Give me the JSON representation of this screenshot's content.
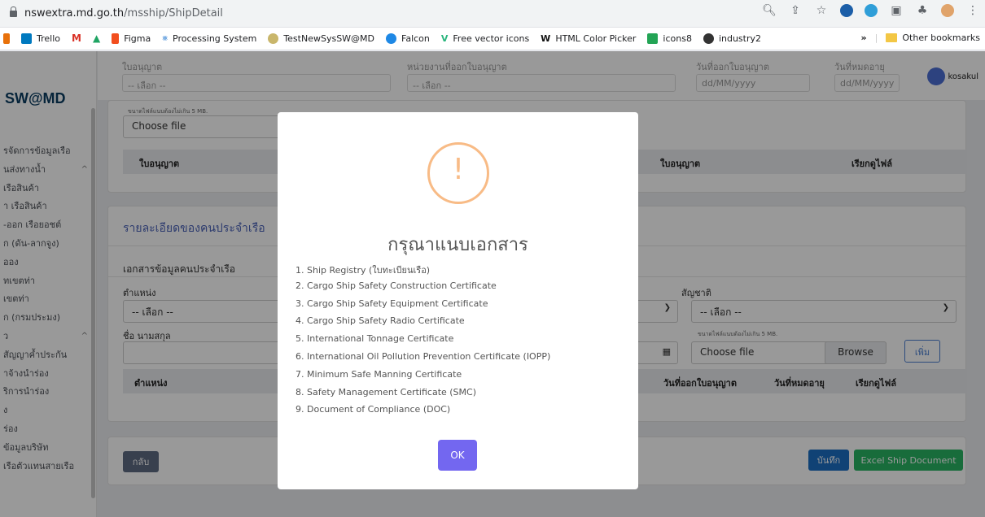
{
  "browser": {
    "url_host": "nswextra.md.go.th",
    "url_path": "/msship/ShipDetail",
    "bookmarks": [
      "Trello",
      "Figma",
      "Processing System",
      "TestNewSysSW@MD",
      "Falcon",
      "Free vector icons",
      "HTML Color Picker",
      "icons8",
      "industry2"
    ],
    "bookmark_overflow": "»",
    "other_bookmarks": "Other bookmarks"
  },
  "app": {
    "logo": "SW@MD",
    "user": "kosakul",
    "sidebar_items": [
      "รจัดการข้อมูลเรือ",
      "นส่งทางน้ำ",
      "เรือสินค้า",
      "า เรือสินค้า",
      "-ออก เรือยอชต์",
      "ก (ดัน-ลากจูง)",
      "ออง",
      "ทเขตท่า",
      "เขตท่า",
      "ก (กรมประมง)",
      "ว",
      "สัญญาค้ำประกัน",
      "าจ้างนำร่อง",
      "ริการนำร่อง",
      "ง",
      "ร่อง",
      "ข้อมูลบริษัท",
      "เรือตัวแทนสายเรือ"
    ],
    "top_fields": {
      "license_label": "ใบอนุญาต",
      "license_value": "-- เลือก --",
      "agency_label": "หน่วยงานที่ออกใบอนุญาต",
      "agency_value": "-- เลือก --",
      "issue_label": "วันที่ออกใบอนุญาต",
      "issue_value": "dd/MM/yyyy",
      "expire_label": "วันที่หมดอายุ",
      "expire_value": "dd/MM/yyyy"
    },
    "file_note": "ขนาดไฟล์แนบต้องไม่เกิน 5 MB.",
    "choose_file": "Choose file",
    "license_table": {
      "col1": "ใบอนุญาต",
      "col2": "ใบอนุญาต",
      "col3": "เรียกดูไฟล์"
    },
    "crew_section": {
      "title": "รายละเอียดของคนประจำเรือ",
      "subtitle": "เอกสารข้อมูลคนประจำเรือ",
      "position_label": "ตำแหน่ง",
      "position_value": "-- เลือก --",
      "nationality_label": "สัญชาติ",
      "nationality_value": "-- เลือก --",
      "name_label": "ชื่อ นามสกุล",
      "file_note": "ขนาดไฟล์แนบต้องไม่เกิน 5 MB.",
      "choose_file": "Choose file",
      "browse": "Browse",
      "add": "เพิ่ม",
      "table": {
        "col1": "ตำแหน่ง",
        "col2": "วันที่ออกใบอนุญาต",
        "col3": "วันที่หมดอายุ",
        "col4": "เรียกดูไฟล์"
      }
    },
    "footer": {
      "back": "กลับ",
      "save": "บันทึก",
      "excel": "Excel Ship Document"
    }
  },
  "modal": {
    "icon": "warning-icon",
    "glyph": "!",
    "title": "กรุณาแนบเอกสาร",
    "documents": [
      "1. Ship Registry (ใบทะเบียนเรือ)",
      "2. Cargo Ship Safety Construction Certificate",
      "3. Cargo Ship Safety Equipment Certificate",
      "4. Cargo Ship Safety Radio Certificate",
      "5. International Tonnage Certificate",
      "6. International Oil Pollution Prevention Certificate (IOPP)",
      "7. Minimum Safe Manning Certificate",
      "8. Safety Management Certificate (SMC)",
      "9. Document of Compliance (DOC)"
    ],
    "ok": "OK"
  },
  "colors": {
    "accent": "#7367f0",
    "warning": "#f8bb86",
    "save": "#1c6fc4",
    "excel": "#28b463",
    "back": "#5e6b82"
  }
}
